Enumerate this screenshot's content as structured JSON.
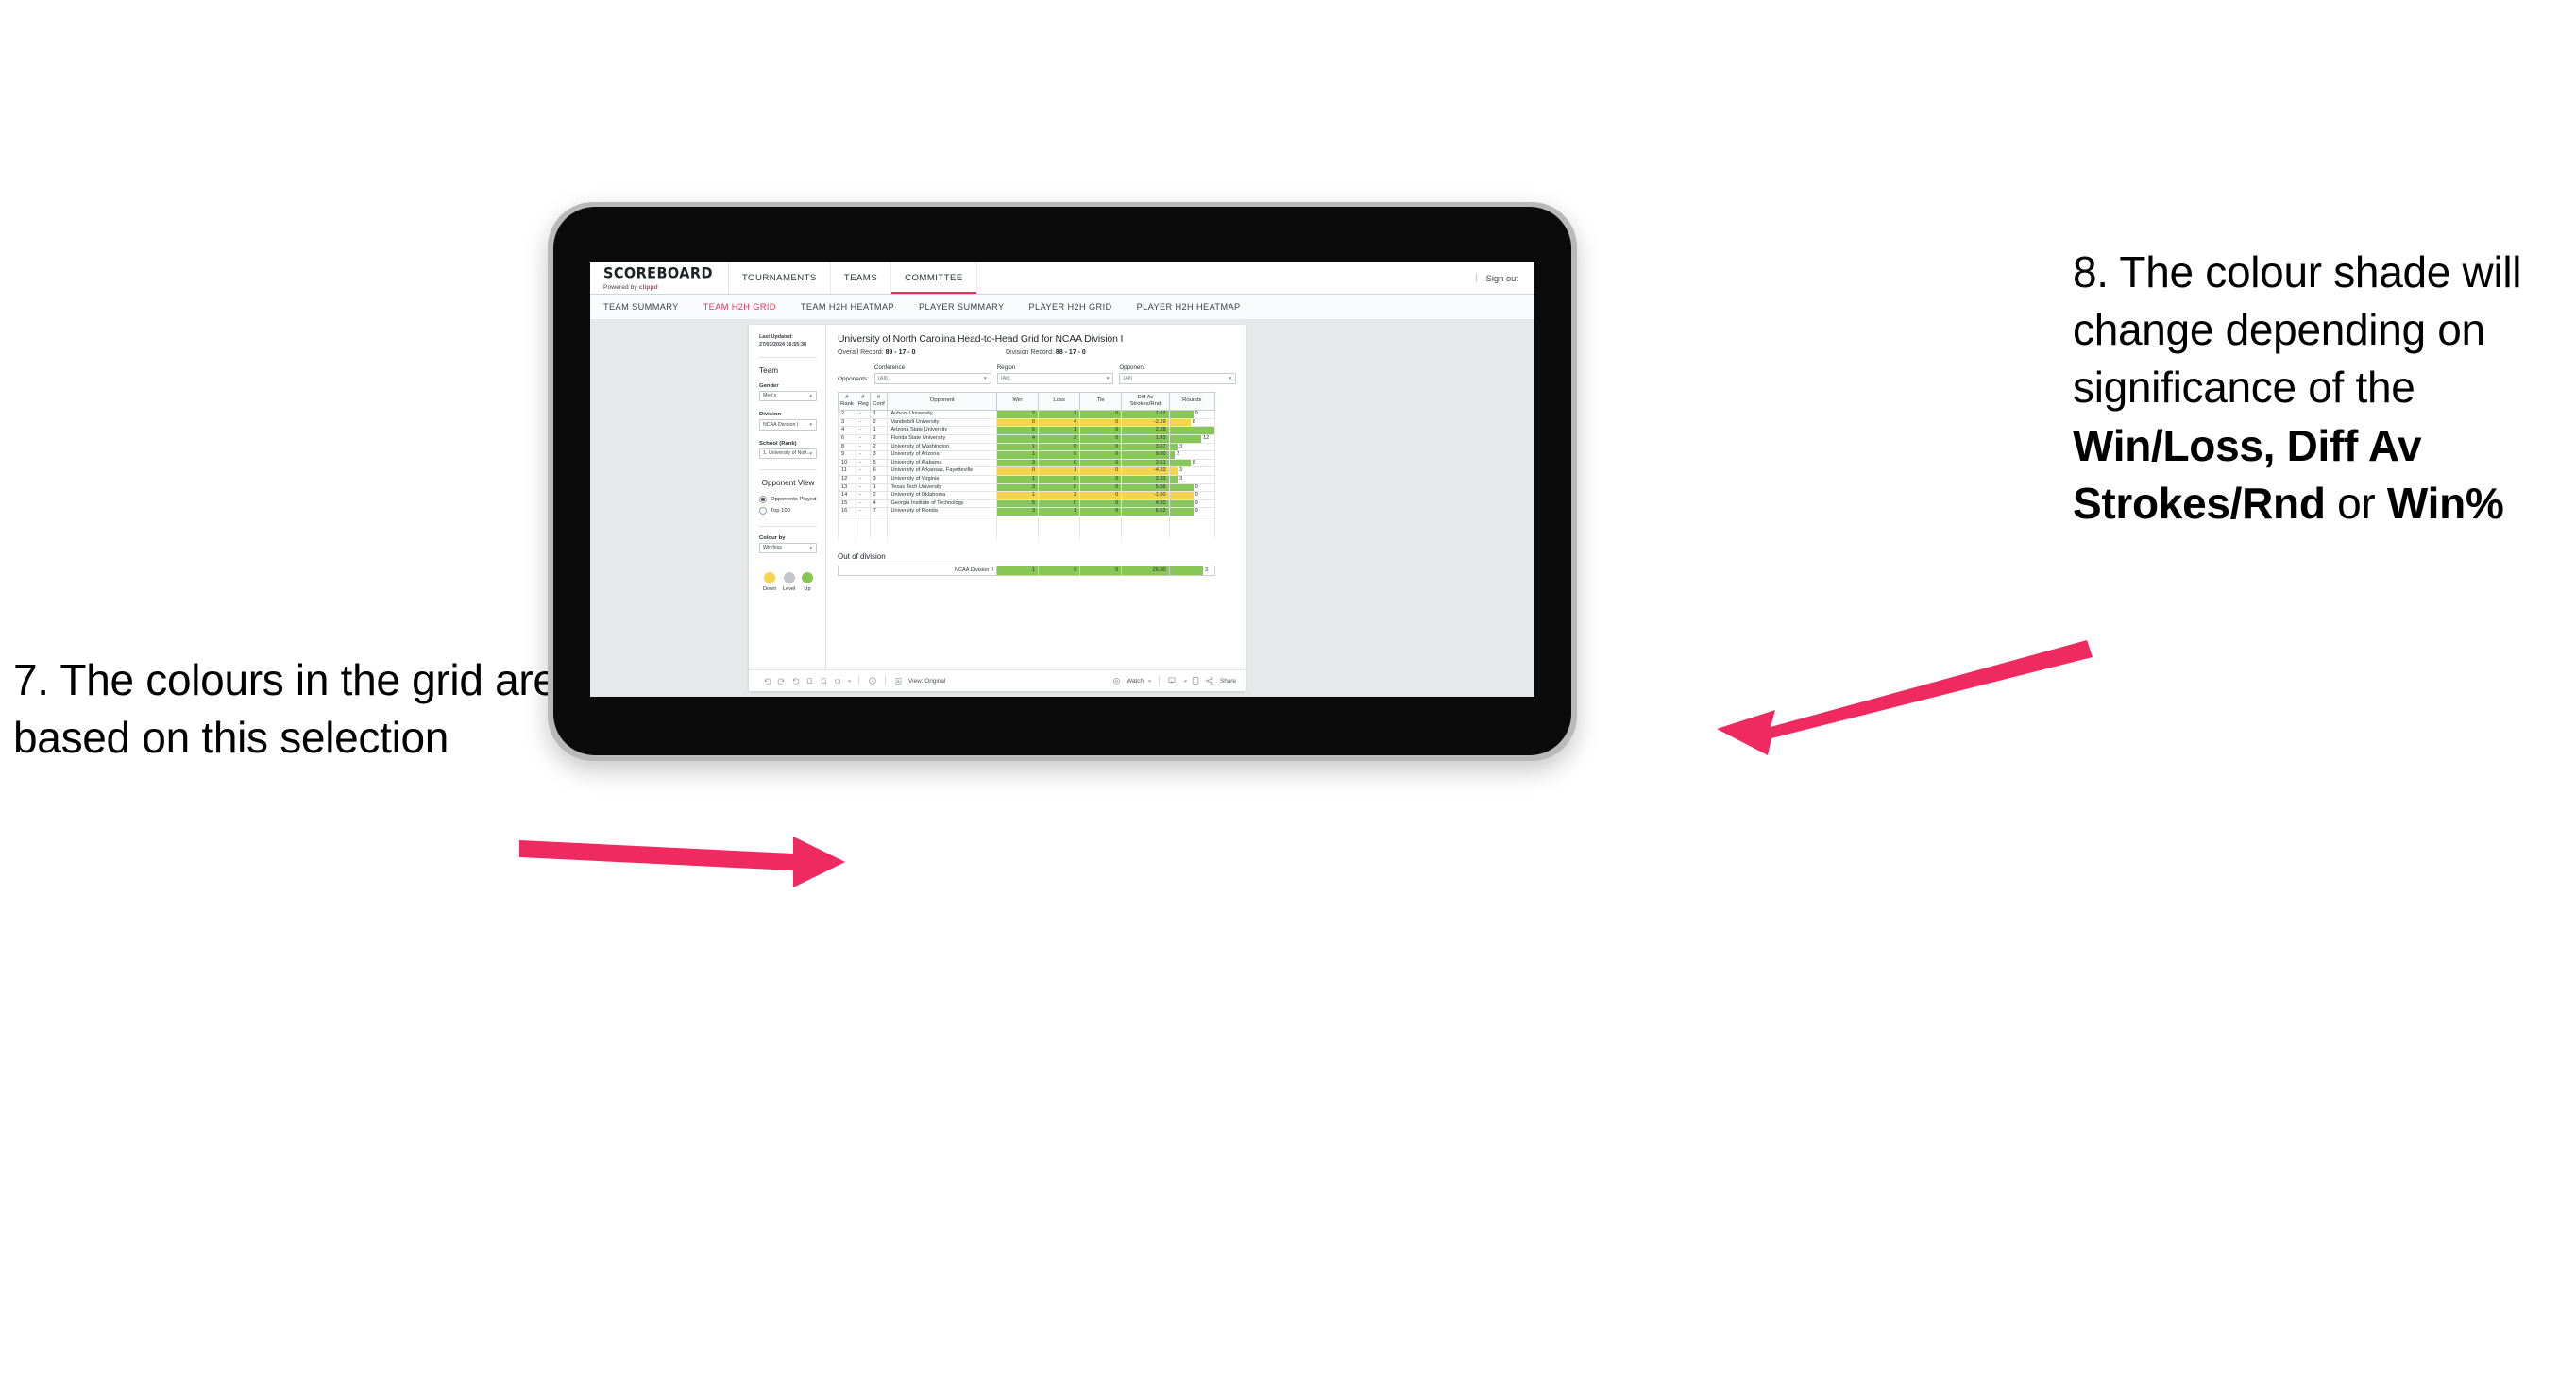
{
  "annotations": {
    "left": {
      "number": "7.",
      "text": "7. The colours in the grid are based on this selection"
    },
    "right": {
      "part1": "8. The colour shade will change depending on significance of the ",
      "bold1": "Win/Loss",
      "mid1": ", ",
      "bold2": "Diff Av Strokes/Rnd",
      "mid2": " or ",
      "bold3": "Win%"
    },
    "arrow_color": "#ee2a60"
  },
  "app": {
    "brand": {
      "title": "SCOREBOARD",
      "powered_prefix": "Powered by ",
      "powered_name": "clippd"
    },
    "topnav": [
      {
        "label": "TOURNAMENTS",
        "active": false
      },
      {
        "label": "TEAMS",
        "active": false
      },
      {
        "label": "COMMITTEE",
        "active": true
      }
    ],
    "signout": {
      "separator": "|",
      "label": "Sign out"
    },
    "subnav": [
      {
        "label": "TEAM SUMMARY",
        "active": false
      },
      {
        "label": "TEAM H2H GRID",
        "active": true
      },
      {
        "label": "TEAM H2H HEATMAP",
        "active": false
      },
      {
        "label": "PLAYER SUMMARY",
        "active": false
      },
      {
        "label": "PLAYER H2H GRID",
        "active": false
      },
      {
        "label": "PLAYER H2H HEATMAP",
        "active": false
      }
    ]
  },
  "sidebar": {
    "last_updated": "Last Updated: 27/03/2024 16:55:38",
    "team_heading": "Team",
    "fields": [
      {
        "label": "Gender",
        "value": "Men's"
      },
      {
        "label": "Division",
        "value": "NCAA Division I"
      },
      {
        "label": "School (Rank)",
        "value": "1. University of Nort..."
      }
    ],
    "opponent_view": {
      "heading": "Opponent View",
      "options": [
        {
          "label": "Opponents Played",
          "selected": true
        },
        {
          "label": "Top 100",
          "selected": false
        }
      ]
    },
    "colour_by": {
      "label": "Colour by",
      "value": "Win/loss"
    },
    "legend": [
      {
        "label": "Down",
        "color": "#f5d householder"
      },
      {
        "label": "Level",
        "color": "#c3c6ca"
      },
      {
        "label": "Up",
        "color": "#86c755"
      }
    ],
    "legend_colors": {
      "down": "#f6d44e",
      "level": "#c3c6ca",
      "up": "#86c755"
    }
  },
  "view": {
    "title": "University of North Carolina Head-to-Head Grid for NCAA Division I",
    "overall_record_label": "Overall Record: ",
    "overall_record_value": "89 - 17 - 0",
    "division_record_label": "Division Record: ",
    "division_record_value": "88 - 17 - 0",
    "opponents_label": "Opponents:",
    "filters": [
      {
        "label": "Conference",
        "value": "(All)"
      },
      {
        "label": "Region",
        "value": "(All)"
      },
      {
        "label": "Opponent",
        "value": "(All)"
      }
    ],
    "columns": [
      "# Rank",
      "# Reg",
      "# Conf",
      "Opponent",
      "Win",
      "Loss",
      "Tie",
      "Diff Av Strokes/Rnd",
      "Rounds"
    ],
    "column_headers": [
      {
        "line1": "#",
        "line2": "Rank"
      },
      {
        "line1": "#",
        "line2": "Reg"
      },
      {
        "line1": "#",
        "line2": "Conf"
      },
      {
        "line1": "Opponent",
        "line2": ""
      },
      {
        "line1": "Win",
        "line2": ""
      },
      {
        "line1": "Loss",
        "line2": ""
      },
      {
        "line1": "Tie",
        "line2": ""
      },
      {
        "line1": "Diff Av",
        "line2": "Strokes/Rnd"
      },
      {
        "line1": "Rounds",
        "line2": ""
      }
    ],
    "rows": [
      {
        "rank": "2",
        "reg": "-",
        "conf": "1",
        "opponent": "Auburn University",
        "win": "2",
        "loss": "1",
        "tie": "0",
        "diff": "1.67",
        "rounds": "9",
        "tone": "up"
      },
      {
        "rank": "3",
        "reg": "-",
        "conf": "2",
        "opponent": "Vanderbilt University",
        "win": "0",
        "loss": "4",
        "tie": "0",
        "diff": "-2.29",
        "rounds": "8",
        "tone": "down"
      },
      {
        "rank": "4",
        "reg": "-",
        "conf": "1",
        "opponent": "Arizona State University",
        "win": "5",
        "loss": "1",
        "tie": "0",
        "diff": "2.28",
        "rounds": "17",
        "tone": "up"
      },
      {
        "rank": "6",
        "reg": "-",
        "conf": "2",
        "opponent": "Florida State University",
        "win": "4",
        "loss": "2",
        "tie": "0",
        "diff": "1.83",
        "rounds": "12",
        "tone": "up"
      },
      {
        "rank": "8",
        "reg": "-",
        "conf": "2",
        "opponent": "University of Washington",
        "win": "1",
        "loss": "0",
        "tie": "0",
        "diff": "3.67",
        "rounds": "3",
        "tone": "up"
      },
      {
        "rank": "9",
        "reg": "-",
        "conf": "3",
        "opponent": "University of Arizona",
        "win": "1",
        "loss": "0",
        "tie": "0",
        "diff": "9.00",
        "rounds": "2",
        "tone": "up"
      },
      {
        "rank": "10",
        "reg": "-",
        "conf": "5",
        "opponent": "University of Alabama",
        "win": "3",
        "loss": "0",
        "tie": "0",
        "diff": "2.61",
        "rounds": "8",
        "tone": "up"
      },
      {
        "rank": "11",
        "reg": "-",
        "conf": "6",
        "opponent": "University of Arkansas, Fayetteville",
        "win": "0",
        "loss": "1",
        "tie": "0",
        "diff": "-4.33",
        "rounds": "3",
        "tone": "down"
      },
      {
        "rank": "12",
        "reg": "-",
        "conf": "3",
        "opponent": "University of Virginia",
        "win": "1",
        "loss": "0",
        "tie": "0",
        "diff": "2.33",
        "rounds": "3",
        "tone": "up"
      },
      {
        "rank": "13",
        "reg": "-",
        "conf": "1",
        "opponent": "Texas Tech University",
        "win": "3",
        "loss": "0",
        "tie": "0",
        "diff": "5.56",
        "rounds": "9",
        "tone": "up"
      },
      {
        "rank": "14",
        "reg": "-",
        "conf": "2",
        "opponent": "University of Oklahoma",
        "win": "1",
        "loss": "2",
        "tie": "0",
        "diff": "-1.00",
        "rounds": "9",
        "tone": "down"
      },
      {
        "rank": "15",
        "reg": "-",
        "conf": "4",
        "opponent": "Georgia Institute of Technology",
        "win": "5",
        "loss": "0",
        "tie": "0",
        "diff": "4.50",
        "rounds": "9",
        "tone": "up"
      },
      {
        "rank": "16",
        "reg": "-",
        "conf": "7",
        "opponent": "University of Florida",
        "win": "3",
        "loss": "1",
        "tie": "0",
        "diff": "6.62",
        "rounds": "9",
        "tone": "up"
      }
    ],
    "out_of_division": {
      "title": "Out of division",
      "row": {
        "label": "NCAA Division II",
        "win": "1",
        "loss": "0",
        "tie": "0",
        "diff": "26.00",
        "rounds": "3",
        "tone": "up"
      }
    },
    "cell_colors": {
      "up": "#86c755",
      "down": "#f6d44e",
      "level": "#c3c6ca"
    },
    "rounds_max": 17
  },
  "toolbar": {
    "icons": [
      "undo-icon",
      "redo-icon",
      "revert-icon",
      "refresh-icon",
      "pause-icon",
      "rectangle-select-icon"
    ],
    "view_label": "View: Original",
    "watch_label": "Watch",
    "share_label": "Share"
  }
}
